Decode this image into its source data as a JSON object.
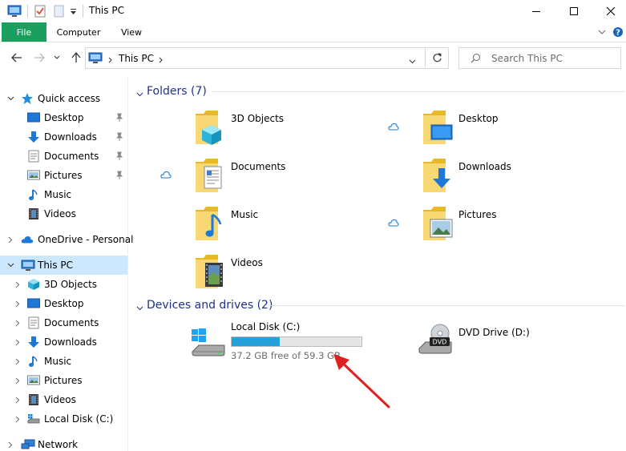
{
  "window": {
    "title": "This PC"
  },
  "ribbon": {
    "tabs": [
      "File",
      "Computer",
      "View"
    ]
  },
  "address": {
    "path": "This PC"
  },
  "search": {
    "placeholder": "Search This PC"
  },
  "sidebar": {
    "quick_access": "Quick access",
    "quick_items": [
      "Desktop",
      "Downloads",
      "Documents",
      "Pictures",
      "Music",
      "Videos"
    ],
    "onedrive": "OneDrive - Personal",
    "this_pc": "This PC",
    "pc_items": [
      "3D Objects",
      "Desktop",
      "Documents",
      "Downloads",
      "Music",
      "Pictures",
      "Videos",
      "Local Disk (C:)"
    ],
    "network": "Network"
  },
  "folders_section": {
    "title": "Folders (7)",
    "items": [
      "3D Objects",
      "Desktop",
      "Documents",
      "Downloads",
      "Music",
      "Pictures",
      "Videos"
    ]
  },
  "drives_section": {
    "title": "Devices and drives (2)",
    "local_disk": {
      "name": "Local Disk (C:)",
      "free_text": "37.2 GB free of 59.3 GB",
      "used_fraction": 0.373
    },
    "dvd": {
      "name": "DVD Drive (D:)",
      "badge": "DVD"
    }
  },
  "colors": {
    "file_tab": "#1a9f5f",
    "selected": "#cce8ff",
    "section_title": "#1e3287",
    "drive_bar": "#26a0da",
    "arrow": "#e02020"
  }
}
